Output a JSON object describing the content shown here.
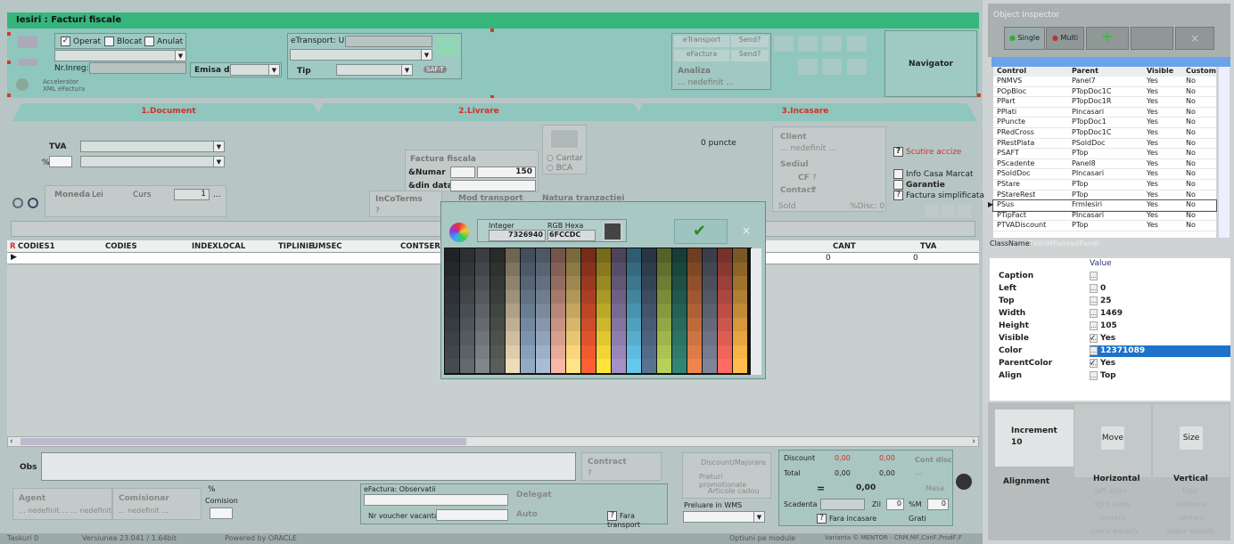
{
  "window": {
    "title": "Iesiri : Facturi fiscale"
  },
  "header": {
    "operat": "Operat",
    "blocat": "Blocat",
    "anulat": "Anulat",
    "nr_inreg": "Nr.Inreg:",
    "emisa_de": "Emisa de",
    "accelerator": "Accelerator XML eFactura",
    "etransport_uit": "eTransport: UIT",
    "tip": "Tip",
    "saf_t": "SAF-T",
    "etransport_btn": "eTransport",
    "send1": "Send?",
    "efactura_btn": "eFactura",
    "send2": "Send?",
    "analiza": "Analiza",
    "analiza_val": "... nedefinit ...",
    "navigator": "Navigator"
  },
  "tabs": [
    {
      "label": "1.Document",
      "color": "#d0312a"
    },
    {
      "label": "2.Livrare",
      "color": "#d0312a"
    },
    {
      "label": "3.Incasare",
      "color": "#d0312a"
    }
  ],
  "document": {
    "tva": "TVA",
    "pct": "%",
    "moneda": "Moneda",
    "lei": "Lei",
    "curs": "Curs",
    "curs_val": "1",
    "factura_fiscala": "Factura fiscala",
    "numar": "&Numar",
    "numar_val": "150",
    "din_data": "&din data",
    "incoterms": "InCoTerms",
    "incoterms_q": "?",
    "mod_transport": "Mod transport",
    "natura": "Natura tranzactiei",
    "cantar": "Cantar",
    "bca": "BCA",
    "puncte": "0 puncte",
    "client": "Client",
    "client_val": "... nedefinit ...",
    "sediul": "Sediul",
    "cf": "CF",
    "cf_q": "?",
    "contact": "Contact",
    "contact_q": "?",
    "sold": "Sold",
    "disc": "%Disc: 0",
    "scutire": "Scutire accize",
    "info_casa": "Info Casa Marcat",
    "garantie": "Garantie",
    "factura_simpl": "Factura simplificata"
  },
  "grid": {
    "columns": [
      "CODIES1",
      "CODIES",
      "INDEXLOCAL",
      "TIPLINIE",
      "UMSEC",
      "CONTSERV",
      "CANT",
      "TVA"
    ],
    "row": {
      "cant": "0",
      "tva": "0"
    }
  },
  "bottom": {
    "obs": "Obs",
    "agent": "Agent",
    "agent_val": "... nedefinit ... ... nedefinit ...",
    "comisionar": "Comisionar",
    "comisionar_val": "... nedefinit ...",
    "comision_pct": "%",
    "comision": "Comision",
    "efactura_obs": "eFactura: Observatii",
    "nr_voucher": "Nr voucher vacanta",
    "delegat": "Delegat",
    "auto": "Auto",
    "fara_transport": "Fara transport",
    "contract": "Contract",
    "contract_q": "?",
    "discount_majorare": "Discount/Majorare",
    "preturi_promo": "Preturi promotionale",
    "articole_cadou": "Articole cadou",
    "preluare_wms": "Preluare in WMS",
    "discount": "Discount",
    "discount_v1": "0,00",
    "discount_v2": "0,00",
    "total": "Total",
    "total_v1": "0,00",
    "total_v2": "0,00",
    "eq": "=",
    "eq_val": "0,00",
    "masa": "Masa",
    "scadenta": "Scadenta",
    "zile": "Zil",
    "zile_val": "0",
    "pm": "%M",
    "pm_val": "0",
    "grati": "Grati",
    "fara_incasare": "Fara incasare",
    "cont_disc": "Cont disc",
    "cont_disc_val": "..."
  },
  "status": {
    "taskuri": "Taskuri 0",
    "versiunea": "Versiunea 23.041 / 1.64bit",
    "powered": "Powered by ORACLE",
    "optiuni": "Optiuni pe module",
    "varianta": "Varianta © MENTOR - CRM,MF,ConF,ProdF,F"
  },
  "color_dialog": {
    "integer_label": "Integer",
    "integer_val": "7326940",
    "rgb_label": "RGB Hexa",
    "rgb_val": "6FCCDC",
    "close": "×"
  },
  "inspector": {
    "title": "Object Inspector",
    "single": "Single",
    "multi": "Multi",
    "columns": [
      "Control",
      "Parent",
      "Visible",
      "Custom"
    ],
    "rows": [
      [
        "PNMVS",
        "Panel7",
        "Yes",
        "No"
      ],
      [
        "POpBloc",
        "PTopDoc1C",
        "Yes",
        "No"
      ],
      [
        "PPart",
        "PTopDoc1R",
        "Yes",
        "No"
      ],
      [
        "PPlati",
        "PIncasari",
        "Yes",
        "No"
      ],
      [
        "PPuncte",
        "PTopDoc1",
        "Yes",
        "No"
      ],
      [
        "PRedCross",
        "PTopDoc1C",
        "Yes",
        "No"
      ],
      [
        "PRestPlata",
        "PSoldDoc",
        "Yes",
        "No"
      ],
      [
        "PSAFT",
        "PTop",
        "Yes",
        "No"
      ],
      [
        "PScadente",
        "Panel8",
        "Yes",
        "No"
      ],
      [
        "PSoldDoc",
        "PIncasari",
        "Yes",
        "No"
      ],
      [
        "PStare",
        "PTop",
        "Yes",
        "No"
      ],
      [
        "PStareRest",
        "PTop",
        "Yes",
        "No"
      ],
      [
        "PSus",
        "FrmIesiri",
        "Yes",
        "No"
      ],
      [
        "PTipFact",
        "PIncasari",
        "Yes",
        "No"
      ],
      [
        "PTVADiscount",
        "PTop",
        "Yes",
        "No"
      ]
    ],
    "classname_label": "ClassName:",
    "classname_val": "TWinMPaintedPanel",
    "value_header": "Value",
    "props": [
      [
        "Caption",
        ""
      ],
      [
        "Left",
        "0"
      ],
      [
        "Top",
        "25"
      ],
      [
        "Width",
        "1469"
      ],
      [
        "Height",
        "105"
      ],
      [
        "Visible",
        "Yes"
      ],
      [
        "Color",
        "12371089"
      ],
      [
        "ParentColor",
        "Yes"
      ],
      [
        "Align",
        "Top"
      ]
    ],
    "increment": "Increment",
    "increment_val": "10",
    "move": "Move",
    "size": "Size",
    "alignment": "Alignment",
    "horizontal": "Horizontal",
    "vertical": "Vertical",
    "h_opts": [
      "left sides",
      "right sides",
      "centers",
      "space equally"
    ],
    "v_opts": [
      "tops",
      "bottoms",
      "centers",
      "space equally"
    ]
  }
}
